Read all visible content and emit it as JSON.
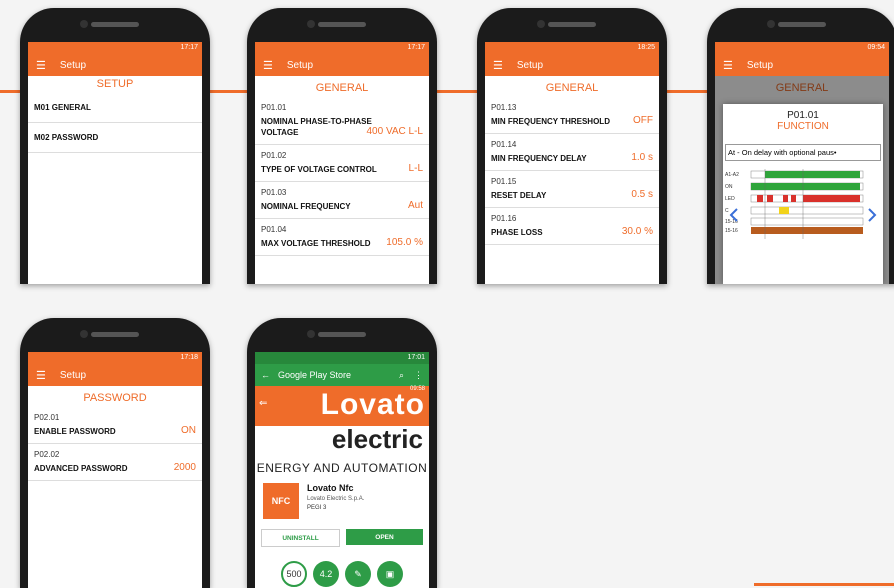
{
  "phone1": {
    "status": "17:17",
    "appbar": "Setup",
    "section": "SETUP",
    "items": [
      "M01 GENERAL",
      "M02 PASSWORD"
    ]
  },
  "phone2": {
    "status": "17:17",
    "appbar": "Setup",
    "section": "GENERAL",
    "rows": [
      {
        "code": "P01.01",
        "label": "NOMINAL PHASE-TO-PHASE VOLTAGE",
        "value": "400 VAC L-L"
      },
      {
        "code": "P01.02",
        "label": "TYPE OF VOLTAGE CONTROL",
        "value": "L-L"
      },
      {
        "code": "P01.03",
        "label": "NOMINAL FREQUENCY",
        "value": "Aut"
      },
      {
        "code": "P01.04",
        "label": "MAX VOLTAGE THRESHOLD",
        "value": "105.0 %"
      }
    ]
  },
  "phone3": {
    "status": "18:25",
    "appbar": "Setup",
    "section": "GENERAL",
    "rows": [
      {
        "code": "P01.13",
        "label": "MIN FREQUENCY THRESHOLD",
        "value": "OFF"
      },
      {
        "code": "P01.14",
        "label": "MIN FREQUENCY DELAY",
        "value": "1.0 s"
      },
      {
        "code": "P01.15",
        "label": "RESET DELAY",
        "value": "0.5 s"
      },
      {
        "code": "P01.16",
        "label": "PHASE LOSS",
        "value": "30.0 %"
      }
    ]
  },
  "phone4": {
    "status": "09:54",
    "appbar": "Setup",
    "section": "GENERAL",
    "dialog_title": "P01.01",
    "dialog_subtitle": "FUNCTION",
    "dialog_select": "At - On delay with optional paus•",
    "timing_labels": [
      "A1-A2",
      "ON",
      "LED",
      "C",
      "15-16",
      "15-16"
    ]
  },
  "phone5": {
    "status": "17:18",
    "appbar": "Setup",
    "section": "PASSWORD",
    "rows": [
      {
        "code": "P02.01",
        "label": "ENABLE PASSWORD",
        "value": "ON"
      },
      {
        "code": "P02.02",
        "label": "ADVANCED PASSWORD",
        "value": "2000"
      }
    ]
  },
  "phone6": {
    "status": "17:01",
    "appbar": "Google Play Store",
    "banner_status": "09:58",
    "brand": "Lovato",
    "brand2": "electric",
    "tagline": "ENERGY AND AUTOMATION",
    "app_name": "Lovato Nfc",
    "developer": "Lovato Electric S.p.A.",
    "rating": "PEGI 3",
    "icon_text": "NFC",
    "uninstall": "UNINSTALL",
    "open": "OPEN",
    "downloads": "500",
    "score": "4.2"
  },
  "colors": {
    "accent": "#ef6c2a",
    "play_green": "#2e9c47"
  }
}
